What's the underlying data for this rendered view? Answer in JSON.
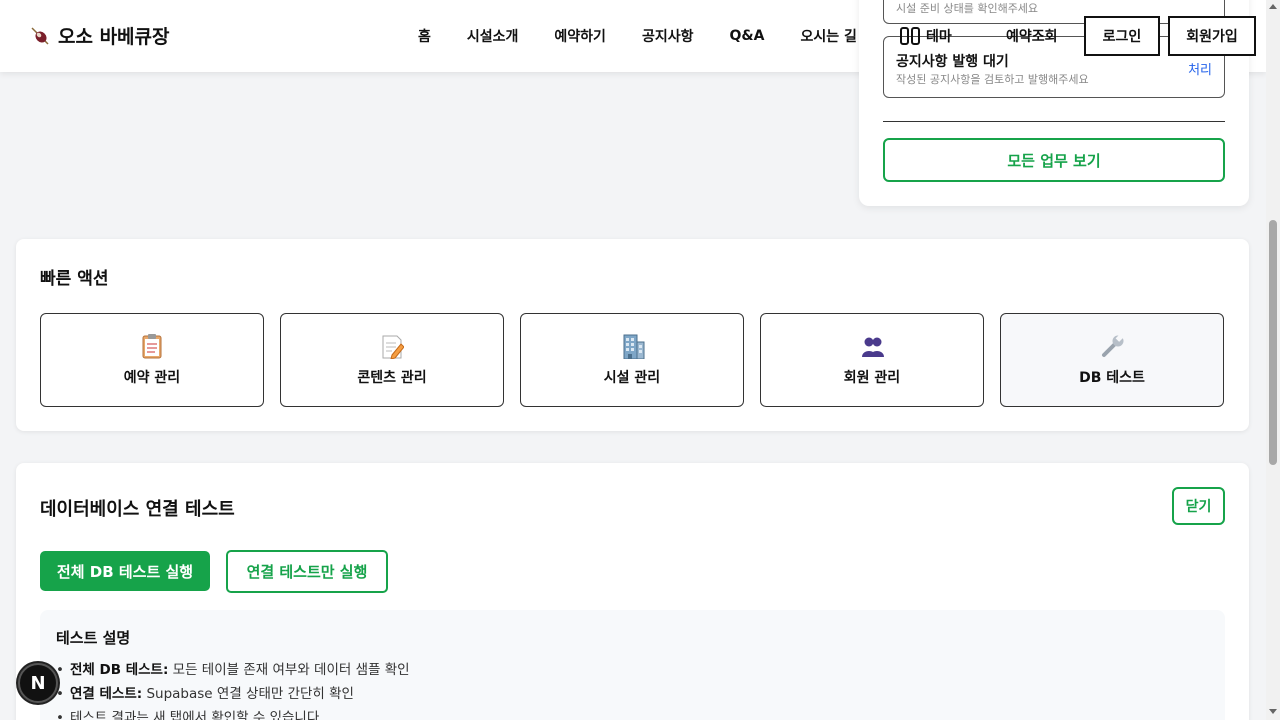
{
  "header": {
    "logo_text": "오소 바베큐장",
    "nav": [
      "홈",
      "시설소개",
      "예약하기",
      "공지사항",
      "Q&A",
      "오시는 길"
    ],
    "theme_label": "테마",
    "lookup_label": "예약조회",
    "login_label": "로그인",
    "signup_label": "회원가입"
  },
  "tasks": {
    "top_card_desc": "시설 준비 상태를 확인해주세요",
    "notice_card": {
      "title": "공지사항 발행 대기",
      "desc": "작성된 공지사항을 검토하고 발행해주세요",
      "action": "처리"
    },
    "all_button": "모든 업무 보기"
  },
  "quick_actions": {
    "title": "빠른 액션",
    "items": [
      {
        "label": "예약 관리",
        "icon": "clipboard-icon"
      },
      {
        "label": "콘텐츠 관리",
        "icon": "memo-icon"
      },
      {
        "label": "시설 관리",
        "icon": "building-icon"
      },
      {
        "label": "회원 관리",
        "icon": "users-icon"
      },
      {
        "label": "DB 테스트",
        "icon": "wrench-icon"
      }
    ]
  },
  "db_test": {
    "title": "데이터베이스 연결 테스트",
    "close_label": "닫기",
    "run_all_label": "전체 DB 테스트 실행",
    "run_conn_label": "연결 테스트만 실행",
    "desc_title": "테스트 설명",
    "items": [
      {
        "bold": "전체 DB 테스트:",
        "text": " 모든 테이블 존재 여부와 데이터 샘플 확인"
      },
      {
        "bold": "연결 테스트:",
        "text": " Supabase 연결 상태만 간단히 확인"
      },
      {
        "bold": "",
        "text": "테스트 결과는 새 탭에서 확인할 수 있습니다"
      }
    ]
  },
  "floating_button_label": "N",
  "colors": {
    "accent_green": "#16a34a",
    "link_blue": "#2563eb"
  }
}
